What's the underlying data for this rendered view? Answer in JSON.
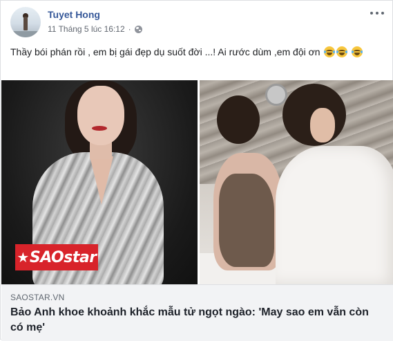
{
  "post": {
    "author": "Tuyet Hong",
    "timestamp": "11 Tháng 5 lúc 16:12",
    "separator": "·",
    "privacy_icon": "globe-icon",
    "more_icon": "more-options-icon",
    "text": "Thầy bói phán rồi , em bị gái đẹp dụ suốt đời ...! Ai rước dùm ,em đội ơn",
    "emoji_icon": "tears-of-joy-emoji-icon"
  },
  "image": {
    "watermark": "SAOstar"
  },
  "link_preview": {
    "source": "SAOSTAR.VN",
    "title": "Bảo Anh khoe khoảnh khắc mẫu tử ngọt ngào: 'May sao em vẫn còn có mẹ'"
  },
  "colors": {
    "author_link": "#365899",
    "watermark_bg": "#d8232a",
    "link_area_bg": "#f2f3f5"
  }
}
